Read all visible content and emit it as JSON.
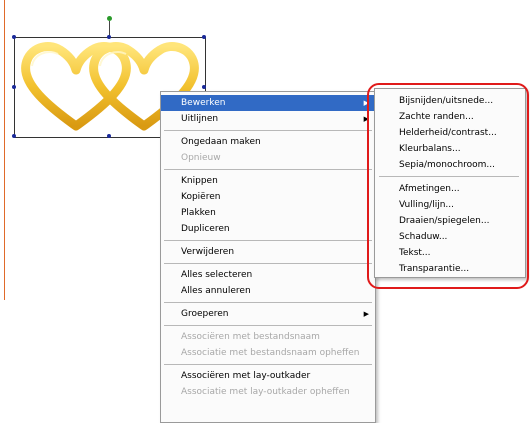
{
  "context_menu": {
    "items": [
      {
        "label": "Bewerken",
        "submenu": true,
        "highlighted": true,
        "disabled": false
      },
      {
        "label": "Uitlijnen",
        "submenu": true,
        "disabled": false
      },
      {
        "separator": true
      },
      {
        "label": "Ongedaan maken",
        "disabled": false
      },
      {
        "label": "Opnieuw",
        "disabled": true
      },
      {
        "separator": true
      },
      {
        "label": "Knippen",
        "disabled": false
      },
      {
        "label": "Kopiëren",
        "disabled": false
      },
      {
        "label": "Plakken",
        "disabled": false
      },
      {
        "label": "Dupliceren",
        "disabled": false
      },
      {
        "separator": true
      },
      {
        "label": "Verwijderen",
        "disabled": false
      },
      {
        "separator": true
      },
      {
        "label": "Alles selecteren",
        "disabled": false
      },
      {
        "label": "Alles annuleren",
        "disabled": false
      },
      {
        "separator": true
      },
      {
        "label": "Groeperen",
        "submenu": true,
        "disabled": false
      },
      {
        "separator": true
      },
      {
        "label": "Associëren met bestandsnaam",
        "disabled": true
      },
      {
        "label": "Associatie met bestandsnaam opheffen",
        "disabled": true
      },
      {
        "separator": true
      },
      {
        "label": "Associëren met lay-outkader",
        "disabled": false
      },
      {
        "label": "Associatie met lay-outkader opheffen",
        "disabled": true
      }
    ]
  },
  "submenu_bewerken": {
    "items": [
      {
        "label": "Bijsnijden/uitsnede..."
      },
      {
        "label": "Zachte randen..."
      },
      {
        "label": "Helderheid/contrast..."
      },
      {
        "label": "Kleurbalans..."
      },
      {
        "label": "Sepia/monochroom..."
      },
      {
        "separator": true
      },
      {
        "label": "Afmetingen..."
      },
      {
        "label": "Vulling/lijn..."
      },
      {
        "label": "Draaien/spiegelen..."
      },
      {
        "label": "Schaduw..."
      },
      {
        "label": "Tekst..."
      },
      {
        "label": "Transparantie..."
      }
    ]
  },
  "colors": {
    "highlight": "#316ac5",
    "annotation": "#e01a1a",
    "hearts": "#f2c12e"
  },
  "icons": [
    "submenu-arrow-icon",
    "hearts-clipart-image",
    "rotation-handle-icon",
    "selection-handle-icon"
  ]
}
